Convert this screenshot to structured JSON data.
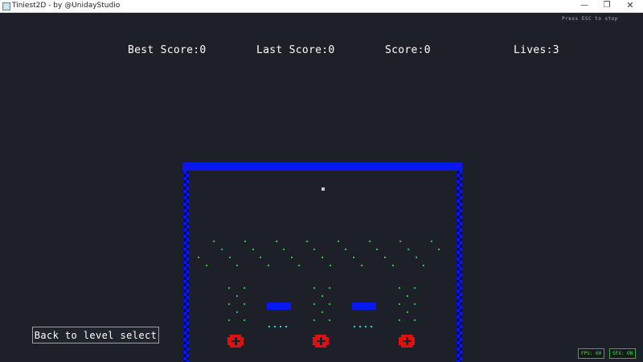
{
  "window": {
    "title": "Tiniest2D - by @UnidayStudio",
    "controls": [
      "minimize",
      "restore",
      "close"
    ]
  },
  "hint": {
    "text": "Press ESC to stop"
  },
  "hud": {
    "best_score": "Best Score:0",
    "last_score": "Last Score:0",
    "score": "Score:0",
    "lives": "Lives:3"
  },
  "buttons": {
    "back": "Back to level select"
  },
  "status": {
    "fps": "FPS: 60",
    "sfx": "SFX: ON"
  },
  "colors": {
    "background": "#1d2028",
    "wall": "#0a18f0",
    "wall_dark": "#050a6a",
    "dot_green": "#24c83c",
    "dot_cyan": "#2fd0d8",
    "target_red": "#e01010",
    "ball": "#c9c9c9"
  }
}
